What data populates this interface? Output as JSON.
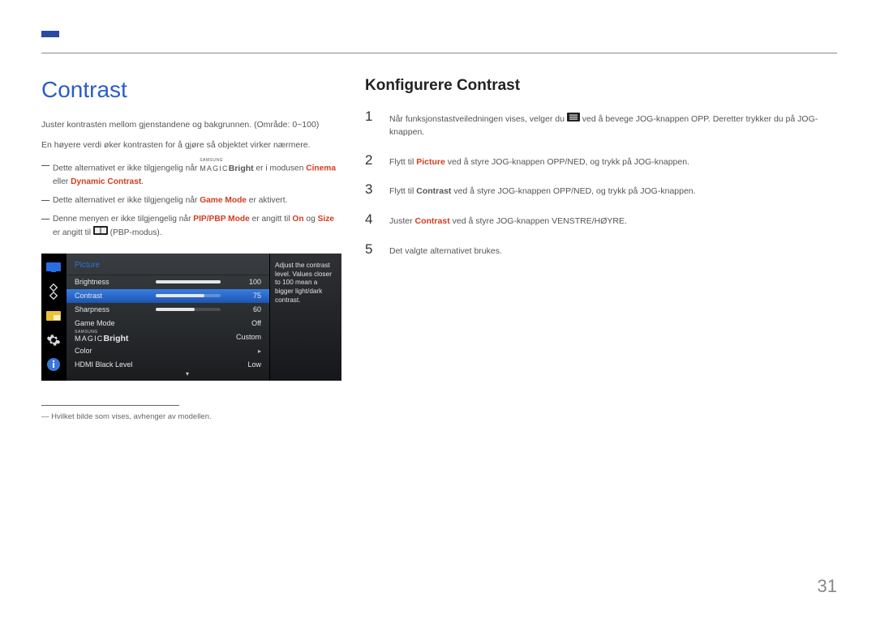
{
  "page": {
    "number": "31"
  },
  "left": {
    "title": "Contrast",
    "p1": "Juster kontrasten mellom gjenstandene og bakgrunnen. (Område: 0~100)",
    "p2": "En høyere verdi øker kontrasten for å gjøre så objektet virker nærmere.",
    "bullets": {
      "b1_pre": "Dette alternativet er ikke tilgjengelig når ",
      "b1_magic_top": "SAMSUNG",
      "b1_magic_bottom": "MAGIC",
      "b1_bright": "Bright",
      "b1_mid": " er i modusen ",
      "b1_kw1": "Cinema",
      "b1_or": " eller ",
      "b1_kw2": "Dynamic Contrast",
      "b1_end": ".",
      "b2_pre": "Dette alternativet er ikke tilgjengelig når ",
      "b2_kw": "Game Mode",
      "b2_end": " er aktivert.",
      "b3_pre": "Denne menyen er ikke tilgjengelig når ",
      "b3_kw1": "PIP/PBP Mode",
      "b3_mid1": " er angitt til ",
      "b3_kw2": "On",
      "b3_mid2": " og ",
      "b3_kw3": "Size",
      "b3_pre2": " er angitt til ",
      "b3_end": " (PBP-modus)."
    },
    "footnote": "Hvilket bilde som vises, avhenger av modellen."
  },
  "osd": {
    "header": "Picture",
    "rows": [
      {
        "name": "Brightness",
        "val": "100",
        "fill": 100,
        "bar": true
      },
      {
        "name": "Contrast",
        "val": "75",
        "fill": 75,
        "bar": true,
        "selected": true
      },
      {
        "name": "Sharpness",
        "val": "60",
        "fill": 60,
        "bar": true
      },
      {
        "name": "Game Mode",
        "val": "Off",
        "bar": false
      },
      {
        "name": "_MAGIC_",
        "val": "Custom",
        "bar": false
      },
      {
        "name": "Color",
        "val": "▸",
        "bar": false,
        "arrow": true
      },
      {
        "name": "HDMI Black Level",
        "val": "Low",
        "bar": false
      }
    ],
    "magic_top": "SAMSUNG",
    "magic_bottom": "MAGIC",
    "magic_bright": "Bright",
    "desc": "Adjust the contrast level. Values closer to 100 mean a bigger light/dark contrast."
  },
  "right": {
    "title": "Konfigurere Contrast",
    "steps": {
      "s1_pre": "Når funksjonstastveiledningen vises, velger du ",
      "s1_post": " ved å bevege JOG-knappen OPP. Deretter trykker du på JOG-knappen.",
      "s2_pre": "Flytt til ",
      "s2_kw": "Picture",
      "s2_post": " ved å styre JOG-knappen OPP/NED, og trykk på JOG-knappen.",
      "s3_pre": "Flytt til ",
      "s3_kw": "Contrast",
      "s3_post": " ved å styre JOG-knappen OPP/NED, og trykk på JOG-knappen.",
      "s4_pre": "Juster ",
      "s4_kw": "Contrast",
      "s4_post": " ved å styre JOG-knappen VENSTRE/HØYRE.",
      "s5": "Det valgte alternativet brukes."
    }
  }
}
